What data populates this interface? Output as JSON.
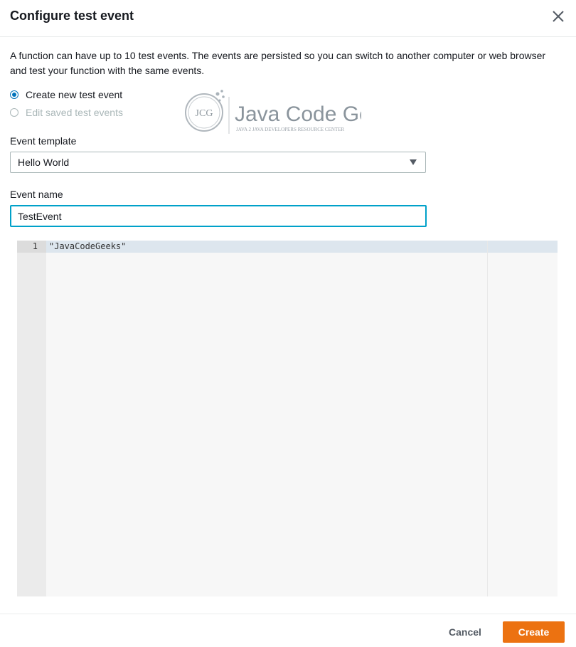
{
  "dialog": {
    "title": "Configure test event",
    "description": "A function can have up to 10 test events. The events are persisted so you can switch to another computer or web browser and test your function with the same events."
  },
  "options": {
    "create_new": "Create new test event",
    "edit_saved": "Edit saved test events"
  },
  "logo": {
    "badge": "JCG",
    "name": "Java Code Geeks",
    "tagline": "Java 2 Java Developers Resource Center"
  },
  "template": {
    "label": "Event template",
    "value": "Hello World"
  },
  "event_name": {
    "label": "Event name",
    "value": "TestEvent"
  },
  "editor": {
    "line_number": "1",
    "code": "\"JavaCodeGeeks\""
  },
  "footer": {
    "cancel": "Cancel",
    "create": "Create"
  },
  "colors": {
    "accent": "#0073bb",
    "focus": "#00a1c9",
    "primary_button": "#ec7211"
  },
  "icons": {
    "close": "close-icon",
    "dropdown": "caret-down-icon"
  }
}
